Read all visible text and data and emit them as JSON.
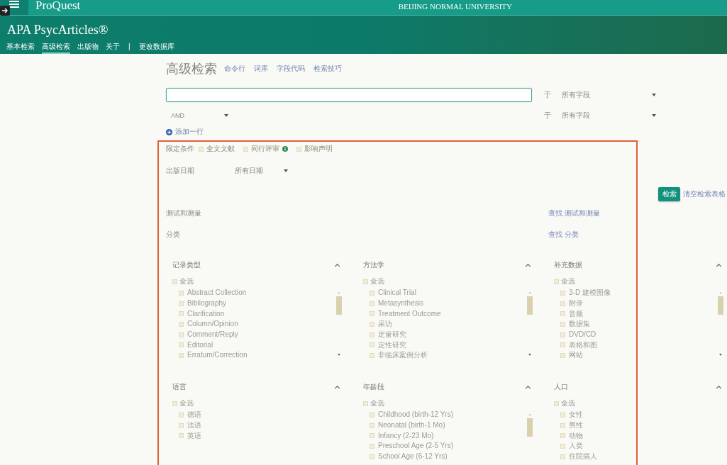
{
  "header": {
    "logo": "ProQuest",
    "institution": "BEIJING NORMAL UNIVERSITY",
    "database": "APA PsycArticles®",
    "tabs": [
      {
        "label": "基本检索",
        "selected": false
      },
      {
        "label": "高级检索",
        "selected": true
      },
      {
        "label": "出版物",
        "selected": false
      },
      {
        "label": "关于",
        "selected": false
      }
    ],
    "divider": "|",
    "change_database": "更改数据库"
  },
  "page": {
    "title": "高级检索",
    "links": [
      "命令行",
      "词库",
      "字段代码",
      "检索技巧"
    ]
  },
  "search_rows": [
    {
      "kind": "input",
      "preposition": "于",
      "field": "所有字段"
    },
    {
      "kind": "operator",
      "operator": "AND",
      "preposition": "于",
      "field": "所有字段"
    }
  ],
  "add_row": "添加一行",
  "limits": {
    "label": "限定条件",
    "options": [
      {
        "label": "全文文献",
        "checked": false,
        "info": false
      },
      {
        "label": "同行评审",
        "checked": false,
        "info": true
      },
      {
        "label": "影响声明",
        "checked": false,
        "info": false
      }
    ]
  },
  "publication_date": {
    "label": "出版日期",
    "value": "所有日期"
  },
  "actions": {
    "search": "检索",
    "clear": "清空检索表格"
  },
  "lookups": [
    {
      "label": "测试和测量",
      "link": "查找 测试和测量"
    },
    {
      "label": "分类",
      "link": "查找 分类"
    }
  ],
  "facets": [
    {
      "title": "记录类型",
      "expanded": true,
      "scrollable": true,
      "select_all": {
        "label": "全选",
        "checked": false
      },
      "items": [
        {
          "label": "Abstract Collection",
          "checked": false
        },
        {
          "label": "Bibliography",
          "checked": false
        },
        {
          "label": "Clarification",
          "checked": false
        },
        {
          "label": "Column/Opinion",
          "checked": false
        },
        {
          "label": "Comment/Reply",
          "checked": false
        },
        {
          "label": "Editorial",
          "checked": false
        },
        {
          "label": "Erratum/Correction",
          "checked": false
        }
      ]
    },
    {
      "title": "方法学",
      "expanded": true,
      "scrollable": true,
      "select_all": {
        "label": "全选",
        "checked": false
      },
      "items": [
        {
          "label": "Clinical Trial",
          "checked": false
        },
        {
          "label": "Metasynthesis",
          "checked": false
        },
        {
          "label": "Treatment Outcome",
          "checked": false
        },
        {
          "label": "采访",
          "checked": false
        },
        {
          "label": "定量研究",
          "checked": false
        },
        {
          "label": "定性研究",
          "checked": false
        },
        {
          "label": "非临床案例分析",
          "checked": false
        }
      ]
    },
    {
      "title": "补充数据",
      "expanded": true,
      "scrollable": true,
      "select_all": {
        "label": "全选",
        "checked": false
      },
      "items": [
        {
          "label": "3-D 建模图像",
          "checked": false
        },
        {
          "label": "附录",
          "checked": false
        },
        {
          "label": "音频",
          "checked": false
        },
        {
          "label": "数据集",
          "checked": false
        },
        {
          "label": "DVD/CD",
          "checked": false
        },
        {
          "label": "表格和图",
          "checked": false
        },
        {
          "label": "网站",
          "checked": false
        }
      ]
    },
    {
      "title": "语言",
      "expanded": true,
      "scrollable": false,
      "select_all": {
        "label": "全选",
        "checked": false
      },
      "items": [
        {
          "label": "德语",
          "checked": false
        },
        {
          "label": "法语",
          "checked": false
        },
        {
          "label": "英语",
          "checked": false
        }
      ]
    },
    {
      "title": "年龄段",
      "expanded": true,
      "scrollable": true,
      "select_all": {
        "label": "全选",
        "checked": false
      },
      "items": [
        {
          "label": "Childhood (birth-12 Yrs)",
          "checked": false
        },
        {
          "label": "Neonatal (birth-1 Mo)",
          "checked": false
        },
        {
          "label": "Infancy (2-23 Mo)",
          "checked": false
        },
        {
          "label": "Preschool Age (2-5 Yrs)",
          "checked": false
        },
        {
          "label": "School Age (6-12 Yrs)",
          "checked": false
        }
      ]
    },
    {
      "title": "人口",
      "expanded": true,
      "scrollable": false,
      "select_all": {
        "label": "全选",
        "checked": false
      },
      "items": [
        {
          "label": "女性",
          "checked": false
        },
        {
          "label": "男性",
          "checked": false
        },
        {
          "label": "动物",
          "checked": false
        },
        {
          "label": "人类",
          "checked": false
        },
        {
          "label": "住院病人",
          "checked": false
        }
      ]
    }
  ]
}
